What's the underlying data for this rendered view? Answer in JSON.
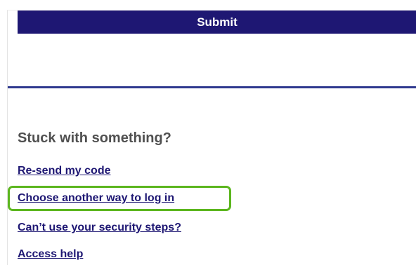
{
  "form": {
    "submit_label": "Submit"
  },
  "help": {
    "heading": "Stuck with something?",
    "links": [
      {
        "label": "Re-send my code"
      },
      {
        "label": "Choose another way to log in",
        "highlighted": true
      },
      {
        "label": "Can’t use your security steps?"
      },
      {
        "label": "Access help"
      }
    ]
  },
  "colors": {
    "brand": "#1e1773",
    "divider": "#2f3a8f",
    "highlight": "#5cb61f",
    "heading": "#505050"
  }
}
